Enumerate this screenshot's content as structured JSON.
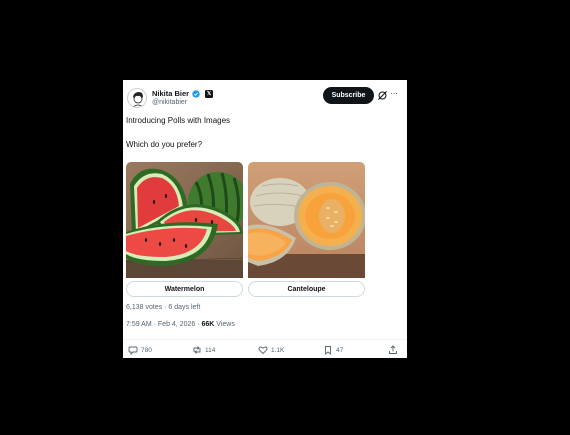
{
  "author": {
    "name": "Nikita Bier",
    "handle": "@nikitabier"
  },
  "header": {
    "subscribe_label": "Subscribe",
    "more_label": "···"
  },
  "post": {
    "line1": "Introducing Polls with Images",
    "line2": "Which do you prefer?"
  },
  "poll": {
    "options": [
      {
        "label": "Watermelon"
      },
      {
        "label": "Canteloupe"
      }
    ],
    "summary": "6,138 votes · 6 days left"
  },
  "meta": {
    "time": "7:59 AM · Feb 4, 2026 · ",
    "views_count": "66K",
    "views_label": " Views"
  },
  "actions": {
    "replies": "780",
    "reposts": "114",
    "likes": "1.1K",
    "bookmarks": "47"
  },
  "colors": {
    "verified": "#1d9bf0",
    "text": "#0f1419",
    "secondary": "#536471"
  },
  "icons": [
    "avatar",
    "verified-icon",
    "x-affiliate-icon",
    "grok-icon",
    "more-icon",
    "reply-icon",
    "repost-icon",
    "like-icon",
    "bookmark-icon",
    "share-icon"
  ]
}
